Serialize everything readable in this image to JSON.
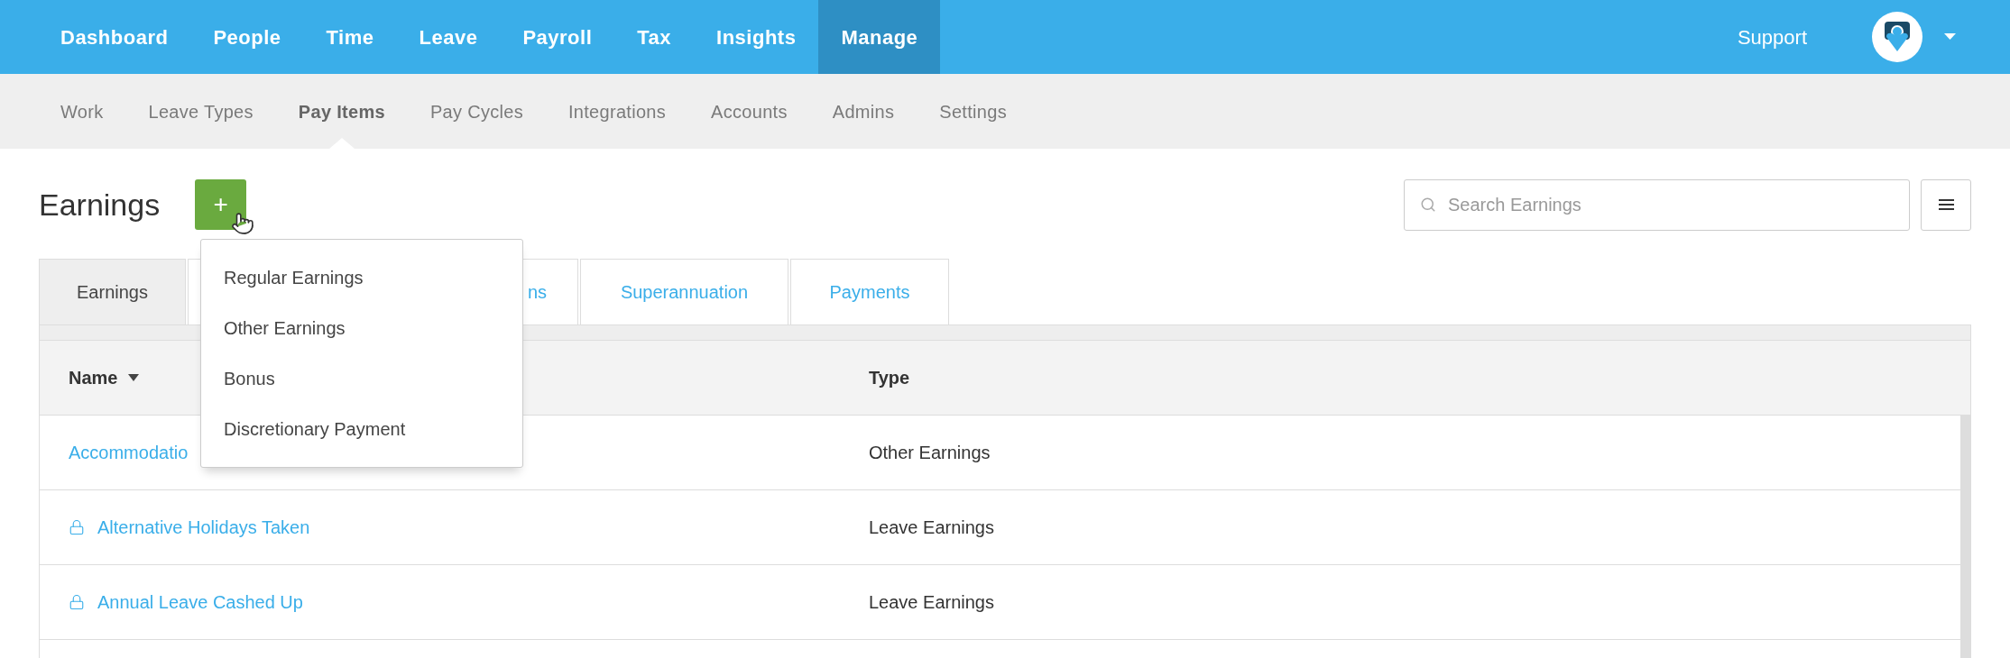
{
  "top_nav": {
    "items": [
      {
        "label": "Dashboard",
        "selected": false
      },
      {
        "label": "People",
        "selected": false
      },
      {
        "label": "Time",
        "selected": false
      },
      {
        "label": "Leave",
        "selected": false
      },
      {
        "label": "Payroll",
        "selected": false
      },
      {
        "label": "Tax",
        "selected": false
      },
      {
        "label": "Insights",
        "selected": false
      },
      {
        "label": "Manage",
        "selected": true
      }
    ],
    "support": "Support"
  },
  "sub_nav": {
    "items": [
      {
        "label": "Work",
        "selected": false
      },
      {
        "label": "Leave Types",
        "selected": false
      },
      {
        "label": "Pay Items",
        "selected": true
      },
      {
        "label": "Pay Cycles",
        "selected": false
      },
      {
        "label": "Integrations",
        "selected": false
      },
      {
        "label": "Accounts",
        "selected": false
      },
      {
        "label": "Admins",
        "selected": false
      },
      {
        "label": "Settings",
        "selected": false
      }
    ]
  },
  "page": {
    "title": "Earnings",
    "add_button": "+",
    "search": {
      "placeholder": "Search Earnings"
    }
  },
  "add_menu": {
    "items": [
      "Regular Earnings",
      "Other Earnings",
      "Bonus",
      "Discretionary Payment"
    ]
  },
  "tabs": [
    {
      "label": "Earnings",
      "selected": true
    },
    {
      "label": "ns",
      "selected": false
    },
    {
      "label": "Superannuation",
      "selected": false
    },
    {
      "label": "Payments",
      "selected": false
    }
  ],
  "table": {
    "columns": [
      {
        "label": "Name",
        "sorted": true
      },
      {
        "label": "Type",
        "sorted": false
      }
    ],
    "rows": [
      {
        "name": "Accommodatio",
        "type": "Other Earnings",
        "locked": false
      },
      {
        "name": "Alternative Holidays Taken",
        "type": "Leave Earnings",
        "locked": true
      },
      {
        "name": "Annual Leave Cashed Up",
        "type": "Leave Earnings",
        "locked": true
      }
    ]
  }
}
